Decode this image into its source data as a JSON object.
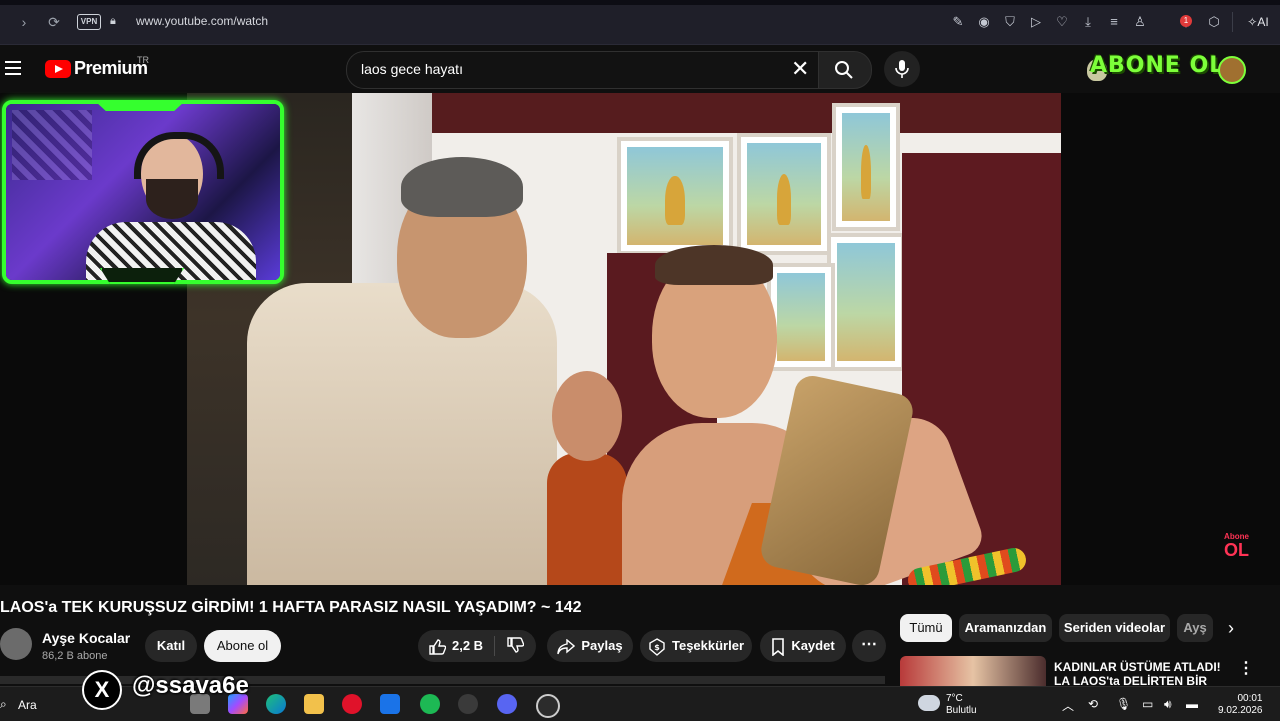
{
  "browser": {
    "url": "www.youtube.com/watch",
    "vpn_label": "VPN",
    "ai_label": "AI",
    "ext_badge_count": "1"
  },
  "header": {
    "brand": "Premium",
    "region": "TR",
    "search_value": "laos gece hayatı",
    "overlay_text": "ABONE OL"
  },
  "video": {
    "corner_badge_top": "Abone",
    "corner_badge_bottom": "OL",
    "title": "LAOS'a TEK KURUŞSUZ GİRDİM! 1 HAFTA PARASIZ NASIL YAŞADIM? ~ 142"
  },
  "channel": {
    "name": "Ayşe Kocalar",
    "subscribers": "86,2 B abone",
    "join_label": "Katıl",
    "subscribe_label": "Abone ol"
  },
  "actions": {
    "like_count": "2,2 B",
    "share_label": "Paylaş",
    "thanks_label": "Teşekkürler",
    "save_label": "Kaydet",
    "more_label": "⋯"
  },
  "filters": {
    "chips": [
      "Tümü",
      "Aramanızdan",
      "Seriden videolar",
      "Ayş"
    ],
    "active_index": 0
  },
  "recommendation": {
    "title": "KADINLAR ÜSTÜME ATLADI! LA LAOS'ta DELİRTEN BİR DÜĞÜN"
  },
  "overlay_social": {
    "handle": "@ssava6e"
  },
  "taskbar": {
    "search_label": "Ara",
    "weather_temp": "7°C",
    "weather_desc": "Bulutlu",
    "time": "00:01",
    "date": "9.02.2026"
  },
  "colors": {
    "youtube_red": "#ff0000",
    "webcam_frame": "#35ff2e",
    "page_bg": "#0f0f0f"
  }
}
